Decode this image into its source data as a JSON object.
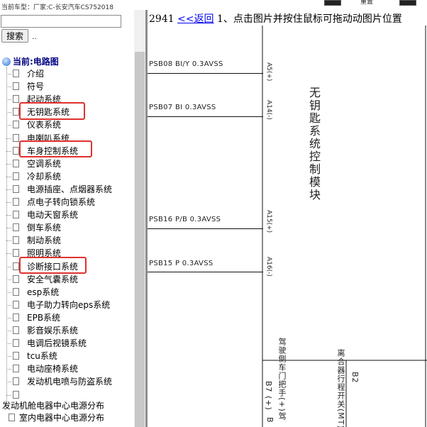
{
  "header": {
    "info": "当前车型：厂家:C-长安汽车CS752018",
    "top_label": "重置"
  },
  "search": {
    "input_value": "",
    "button_label": "搜索",
    "trailing": ".."
  },
  "tree": {
    "root_label": "当前:电路图",
    "items": [
      "介绍",
      "符号",
      "起动系统",
      "无钥匙系统",
      "仪表系统",
      "电喇叭系统",
      "车身控制系统",
      "空调系统",
      "冷却系统",
      "电源插座、点烟器系统",
      "点电子转向锁系统",
      "电动天窗系统",
      "倒车系统",
      "制动系统",
      "照明系统",
      "诊断接口系统",
      "安全气囊系统",
      "esp系统",
      "电子助力转向eps系统",
      "EPB系统",
      "影音娱乐系统",
      "电调后视镜系统",
      "tcu系统",
      "电动座椅系统",
      "发动机电喷与防盗系统",
      ""
    ],
    "tail_group": "发动机舱电器中心电源分布",
    "tail_item": "室内电器中心电源分布"
  },
  "nav": {
    "page_num": "2941",
    "back_label": "<<返回",
    "instruction": "1、点击图片并按住鼠标可拖动动图片位置"
  },
  "diagram": {
    "signals": [
      "PSB08 BI/Y 0.3AVSS",
      "PSB07 BI 0.3AVSS",
      "PSB16 P/B 0.3AVSS",
      "PSB15 P 0.3AVSS"
    ],
    "pins": [
      "A5(+)",
      "A14(-)",
      "A15(+)",
      "A16(-)"
    ],
    "module_label": "无钥匙系统控制模块",
    "lower_label_left": "驾驶侧车门把手(+)驾",
    "lower_pin": "B7 (+)",
    "lower_b": "B",
    "lower_label_right": "离合器行程开关(MT)",
    "lower_pin_right": "B2"
  }
}
